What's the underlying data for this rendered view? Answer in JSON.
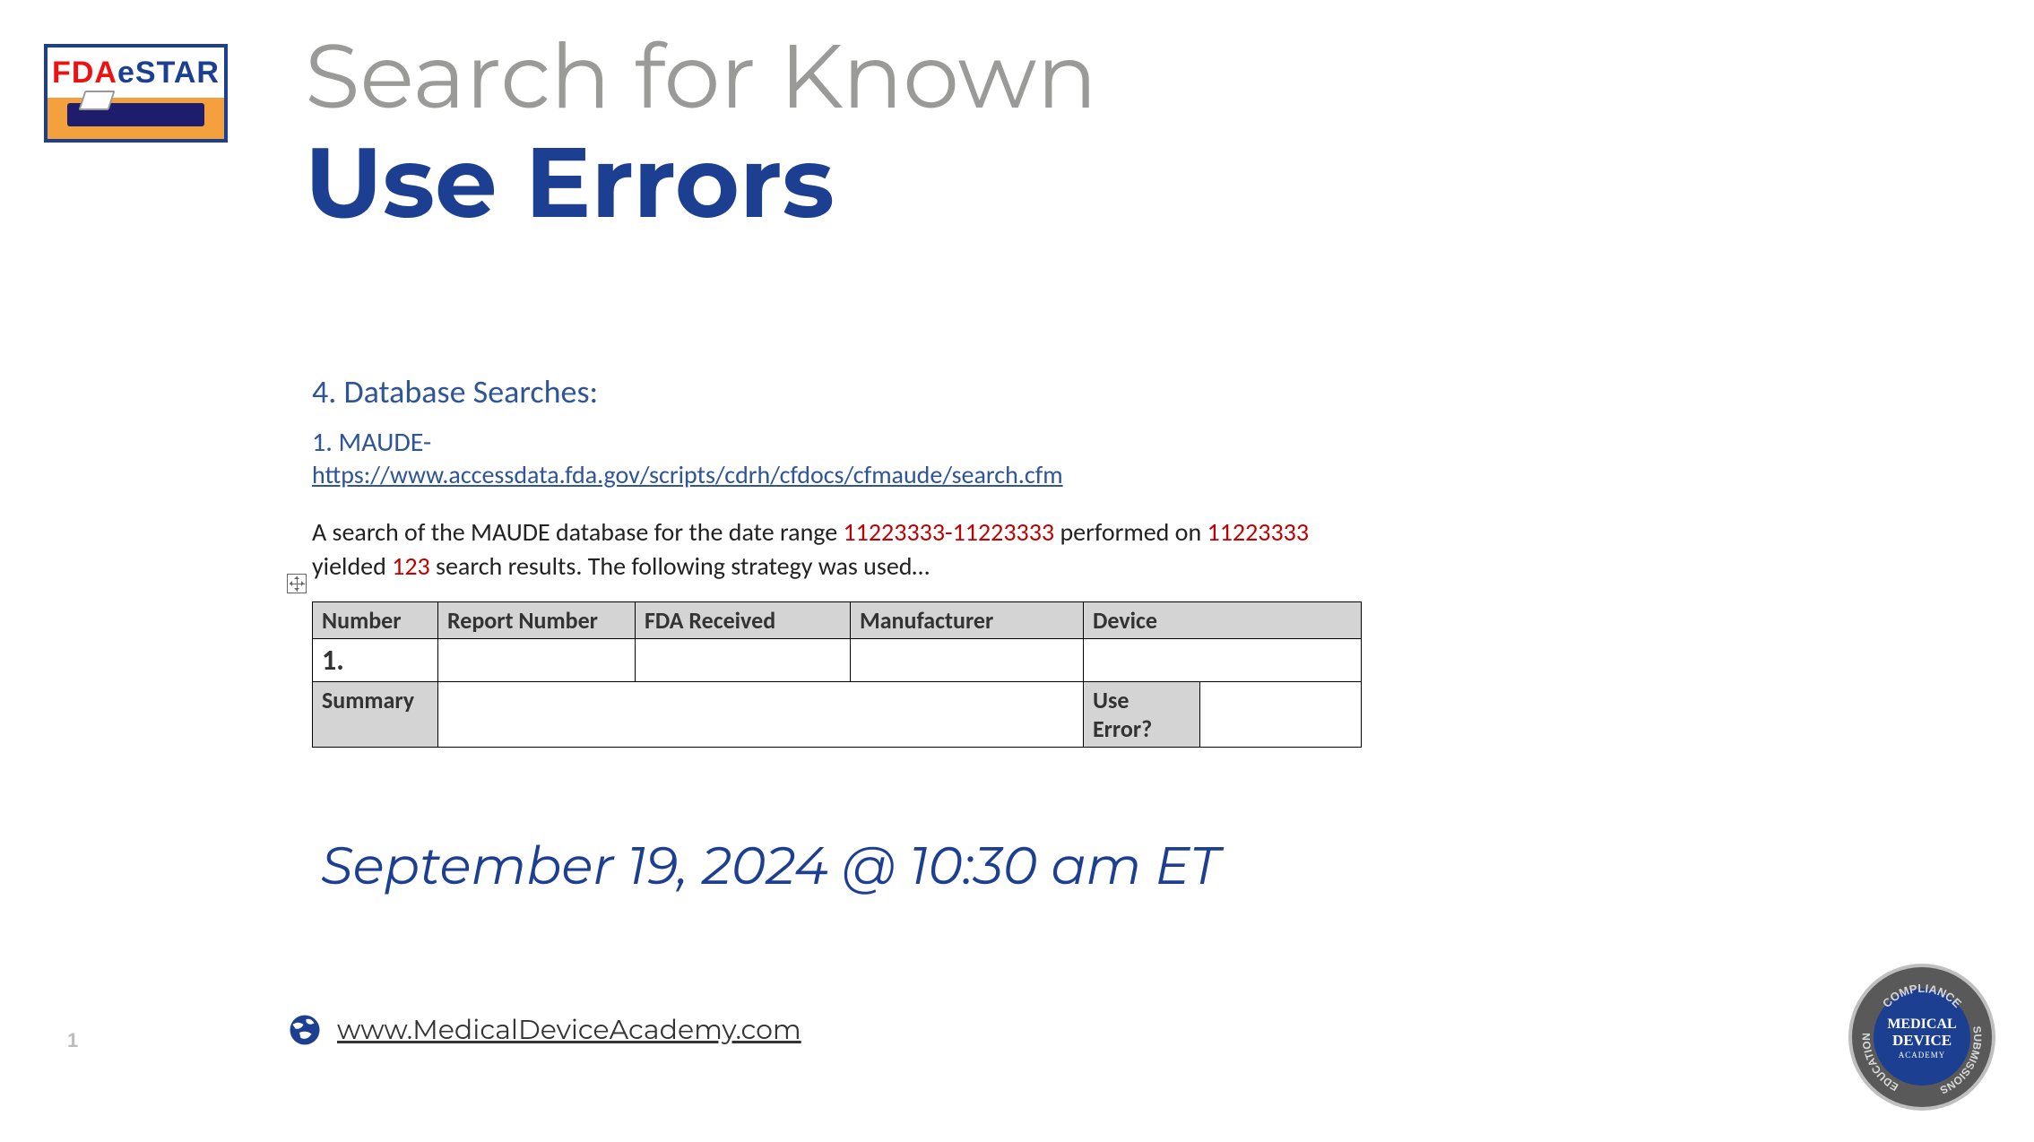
{
  "logo": {
    "text": "FDAeSTAR"
  },
  "title": {
    "line1": "Search for Known",
    "line2": "Use Errors"
  },
  "section": {
    "heading": "4. Database Searches:",
    "sub_heading": "1. MAUDE-",
    "link_text": "https://www.accessdata.fda.gov/scripts/cdrh/cfdocs/cfmaude/search.cfm",
    "para_pre": "A search of the MAUDE database for the date range ",
    "date_range": "11223333-11223333",
    "para_mid1": " performed on ",
    "performed_on": "11223333",
    "para_mid2": " yielded ",
    "result_count": "123",
    "para_post": " search results. The following strategy was used…"
  },
  "table": {
    "headers": [
      "Number",
      "Report Number",
      "FDA Received",
      "Manufacturer",
      "Device"
    ],
    "row1_number": "1.",
    "summary_label": "Summary",
    "use_error_label": "Use Error?"
  },
  "date_line": "September 19, 2024 @ 10:30 am ET",
  "footer": {
    "page_number": "1",
    "link_text": "www.MedicalDeviceAcademy.com"
  },
  "mda_badge": {
    "center_text_1": "MEDICAL",
    "center_text_2": "DEVICE",
    "center_text_3": "ACADEMY",
    "ring_top": "COMPLIANCE",
    "ring_left": "EDUCATION",
    "ring_right": "SUBMISSIONS"
  }
}
